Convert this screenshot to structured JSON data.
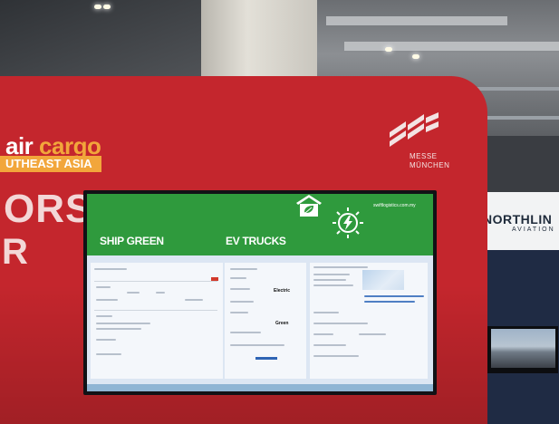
{
  "booth": {
    "brand_air": "air",
    "brand_cargo": "cargo",
    "brand_region": "UTHEAST ASIA",
    "big_text_1": "ORS",
    "big_text_2": "R",
    "partner_line_1": "MESSE",
    "partner_line_2": "MÜNCHEN"
  },
  "neighbor_booth": {
    "name": "NORTHLIN",
    "subtitle": "AVIATION"
  },
  "screen": {
    "url": "swiftlogistics.com.my",
    "headline_left": "SHIP GREEN",
    "headline_right": "EV TRUCKS",
    "vehicle_type_value": "Electric",
    "emission_value": "Green",
    "icons": [
      "leaf-house-icon",
      "lightning-bolt-icon"
    ]
  },
  "colors": {
    "booth_red": "#c4262d",
    "brand_orange": "#f2a63b",
    "screen_green": "#2f9a3d",
    "neighbor_navy": "#1f2b44"
  }
}
